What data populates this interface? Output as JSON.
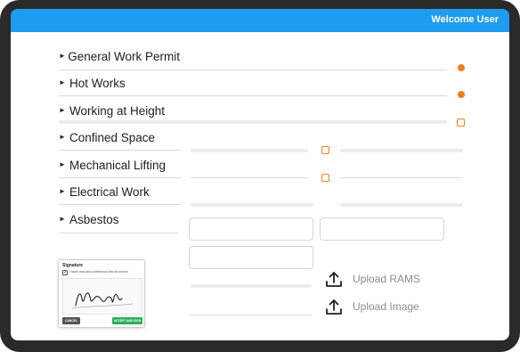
{
  "header": {
    "welcome": "Welcome User"
  },
  "permits": [
    {
      "label": "General Work Permit"
    },
    {
      "label": "Hot Works"
    },
    {
      "label": "Working at Height"
    },
    {
      "label": "Confined Space"
    },
    {
      "label": "Mechanical Lifting"
    },
    {
      "label": "Electrical Work"
    },
    {
      "label": "Asbestos"
    }
  ],
  "uploads": {
    "rams_label": "Upload RAMS",
    "image_label": "Upload Image"
  },
  "signature": {
    "title": "Signature",
    "consent": "I have read and understood this document",
    "cancel_label": "CANCEL",
    "accept_label": "ACCEPT AND SIGN"
  },
  "colors": {
    "accent": "#1f9bf0",
    "status_orange": "#f07f19",
    "accept_green": "#2fae5a",
    "cancel_gray": "#555555"
  },
  "icons": [
    "expand-arrow-icon",
    "upload-icon",
    "status-dot-icon",
    "pending-ring-icon",
    "checkbox-icon"
  ]
}
